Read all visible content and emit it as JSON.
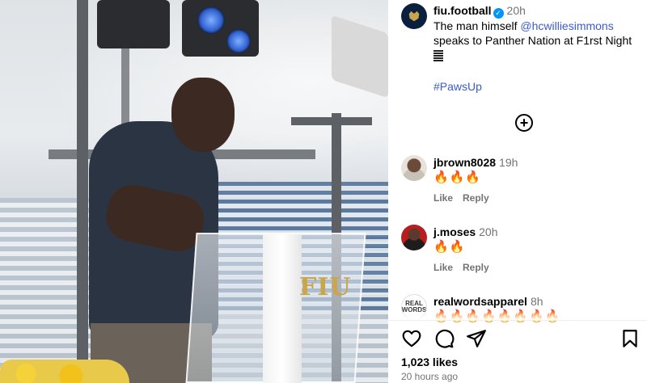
{
  "post": {
    "username": "fiu.football",
    "time": "20h",
    "caption_before": "The man himself ",
    "mention": "@hcwilliesimmons",
    "caption_after": " speaks to Panther Nation at F1rst Night",
    "hashtag": "#PawsUp",
    "podium_logo": "FIU"
  },
  "comments": [
    {
      "username": "jbrown8028",
      "time": "19h",
      "emoji": "🔥🔥🔥",
      "like": "Like",
      "reply": "Reply"
    },
    {
      "username": "j.moses",
      "time": "20h",
      "emoji": "🔥🔥",
      "like": "Like",
      "reply": "Reply"
    },
    {
      "username": "realwordsapparel",
      "time": "8h",
      "emoji": "🔥🔥🔥🔥🔥🔥🔥🔥",
      "avatar_text": "REAL WORDS"
    }
  ],
  "footer": {
    "likes": "1,023 likes",
    "posted": "20 hours ago"
  },
  "icons": [
    "verified-badge-icon",
    "add-circle-icon",
    "heart-icon",
    "comment-icon",
    "share-icon",
    "bookmark-icon"
  ],
  "colors": {
    "link": "#3b5bcc",
    "verified": "#0095f6",
    "muted": "#737373"
  }
}
